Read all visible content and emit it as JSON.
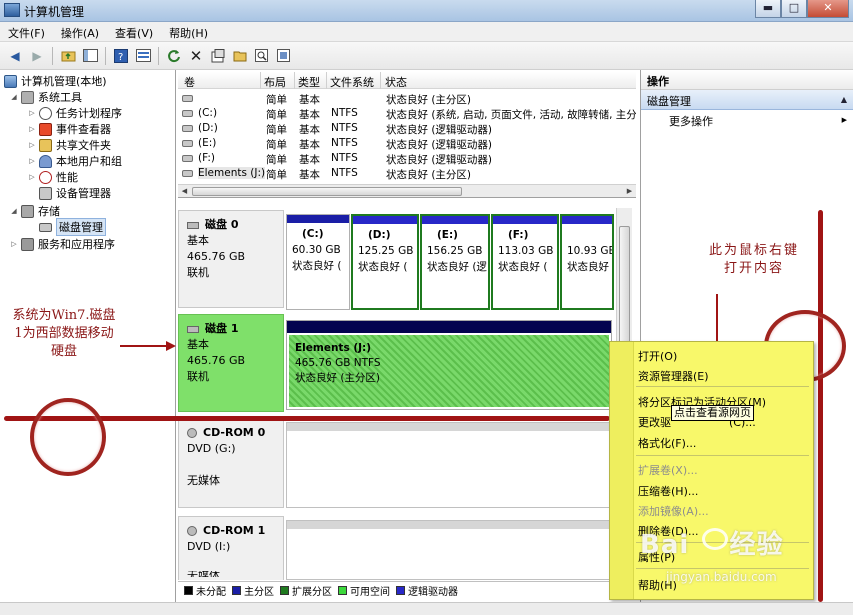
{
  "window": {
    "title": "计算机管理",
    "minimize_glyph": "▬",
    "maximize_glyph": "□",
    "close_glyph": "✕"
  },
  "menubar": [
    "文件(F)",
    "操作(A)",
    "查看(V)",
    "帮助(H)"
  ],
  "toolbar": {
    "icons": [
      "back-icon",
      "forward-icon",
      "up-folder-icon",
      "show-hide-tree-icon",
      "help-icon",
      "properties-icon",
      "refresh-icon",
      "delete-icon",
      "properties-sheet-icon",
      "open-folder-icon",
      "search-icon",
      "export-icon"
    ]
  },
  "tree": {
    "root": "计算机管理(本地)",
    "system_tools": "系统工具",
    "task_scheduler": "任务计划程序",
    "event_viewer": "事件查看器",
    "shared_folders": "共享文件夹",
    "local_users": "本地用户和组",
    "performance": "性能",
    "device_manager": "设备管理器",
    "storage": "存储",
    "disk_management": "磁盘管理",
    "services_apps": "服务和应用程序"
  },
  "volume_list": {
    "columns": [
      "卷",
      "布局",
      "类型",
      "文件系统",
      "状态"
    ],
    "rows": [
      {
        "volume": "",
        "layout": "简单",
        "type": "基本",
        "fs": "",
        "status": "状态良好 (主分区)"
      },
      {
        "volume": "(C:)",
        "layout": "简单",
        "type": "基本",
        "fs": "NTFS",
        "status": "状态良好 (系统, 启动, 页面文件, 活动, 故障转储, 主分"
      },
      {
        "volume": "(D:)",
        "layout": "简单",
        "type": "基本",
        "fs": "NTFS",
        "status": "状态良好 (逻辑驱动器)"
      },
      {
        "volume": "(E:)",
        "layout": "简单",
        "type": "基本",
        "fs": "NTFS",
        "status": "状态良好 (逻辑驱动器)"
      },
      {
        "volume": "(F:)",
        "layout": "简单",
        "type": "基本",
        "fs": "NTFS",
        "status": "状态良好 (逻辑驱动器)"
      },
      {
        "volume": "Elements (J:)",
        "layout": "简单",
        "type": "基本",
        "fs": "NTFS",
        "status": "状态良好 (主分区)"
      }
    ]
  },
  "disk0": {
    "name": "磁盘 0",
    "type": "基本",
    "size": "465.76 GB",
    "state": "联机",
    "partitions": [
      {
        "letter": "(C:)",
        "size": "60.30 GB",
        "status": "状态良好 ("
      },
      {
        "letter": "(D:)",
        "size": "125.25 GB",
        "status": "状态良好 ("
      },
      {
        "letter": "(E:)",
        "size": "156.25 GB",
        "status": "状态良好 (逻"
      },
      {
        "letter": "(F:)",
        "size": "113.03 GB",
        "status": "状态良好 ("
      },
      {
        "letter": "",
        "size": "10.93 GB",
        "status": "状态良好 ("
      }
    ]
  },
  "disk1": {
    "name": "磁盘 1",
    "type": "基本",
    "size": "465.76 GB",
    "state": "联机",
    "partition": {
      "label": "Elements  (J:)",
      "size_fs": "465.76 GB NTFS",
      "status": "状态良好 (主分区)"
    }
  },
  "cdrom0": {
    "name": "CD-ROM 0",
    "drive": "DVD (G:)",
    "media": "无媒体"
  },
  "cdrom1": {
    "name": "CD-ROM 1",
    "drive": "DVD (I:)",
    "media": "无媒体"
  },
  "legend": [
    {
      "label": "未分配",
      "color": "#000000"
    },
    {
      "label": "主分区",
      "color": "#1a1ea6"
    },
    {
      "label": "扩展分区",
      "color": "#1f7a1f"
    },
    {
      "label": "可用空间",
      "color": "#3cd83c"
    },
    {
      "label": "逻辑驱动器",
      "color": "#2828c8"
    }
  ],
  "actions": {
    "header": "操作",
    "section": "磁盘管理",
    "more": "更多操作"
  },
  "context_menu": {
    "open": "打开(O)",
    "explore": "资源管理器(E)",
    "mark_active": "将分区标记为活动分区(M)",
    "change_letter": "更改驱",
    "change_letter_tail": "(C)...",
    "format": "格式化(F)...",
    "extend": "扩展卷(X)...",
    "shrink": "压缩卷(H)...",
    "add_mirror": "添加镜像(A)...",
    "delete": "删除卷(D)...",
    "properties": "属性(P)",
    "help": "帮助(H)"
  },
  "tooltip": "点击查看源网页",
  "annotations": {
    "left": "系统为Win7.磁盘1为西部数据移动硬盘",
    "right": "此为鼠标右键打开内容"
  },
  "watermark": {
    "text": "Bai",
    "text2": "经验",
    "url": "jingyan.baidu.com"
  },
  "colors": {
    "annotation_red": "#a01414",
    "highlight_yellow": "#f8f86a",
    "free_space_green": "#7fe06a"
  }
}
